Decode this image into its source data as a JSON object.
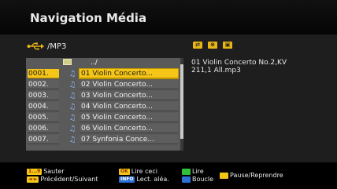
{
  "header": {
    "title": "Navigation Média"
  },
  "path": {
    "icon": "usb-icon",
    "text": "/MP3"
  },
  "mode_icons": [
    {
      "name": "shuffle-mode-icon",
      "glyph": "⇄"
    },
    {
      "name": "repeat-mode-icon",
      "glyph": "⊕"
    },
    {
      "name": "display-mode-icon",
      "glyph": "▣"
    }
  ],
  "file_list": {
    "up_label": "../",
    "rows": [
      {
        "num": "0001.",
        "name": "01 Violin Concerto...",
        "selected": true
      },
      {
        "num": "0002.",
        "name": "02 Violin Concerto...",
        "selected": false
      },
      {
        "num": "0003.",
        "name": "03 Violin Concerto...",
        "selected": false
      },
      {
        "num": "0004.",
        "name": "04 Violin Concerto...",
        "selected": false
      },
      {
        "num": "0005.",
        "name": "05 Violin Concerto...",
        "selected": false
      },
      {
        "num": "0006.",
        "name": "06 Violin Concerto...",
        "selected": false
      },
      {
        "num": "0007.",
        "name": "07 Synfonia Conce...",
        "selected": false
      }
    ]
  },
  "info": {
    "line1": "01 Violin Concerto No.2,KV",
    "line2": "211,1 All.mp3"
  },
  "footer": {
    "keys": {
      "digits": "1...9",
      "arrows": "◄ ►",
      "ok": "OK",
      "info": "INFO"
    },
    "labels": {
      "skip": "Sauter",
      "prev_next": "Précédent/Suivant",
      "play_this": "Lire ceci",
      "shuffle": "Lect. aléa.",
      "play": "Lire",
      "loop": "Boucle",
      "pause_resume": "Pause/Reprendre"
    }
  },
  "colors": {
    "accent_yellow": "#f5c518",
    "green_key": "#2fbf3a",
    "blue_key": "#2c6fd6"
  }
}
